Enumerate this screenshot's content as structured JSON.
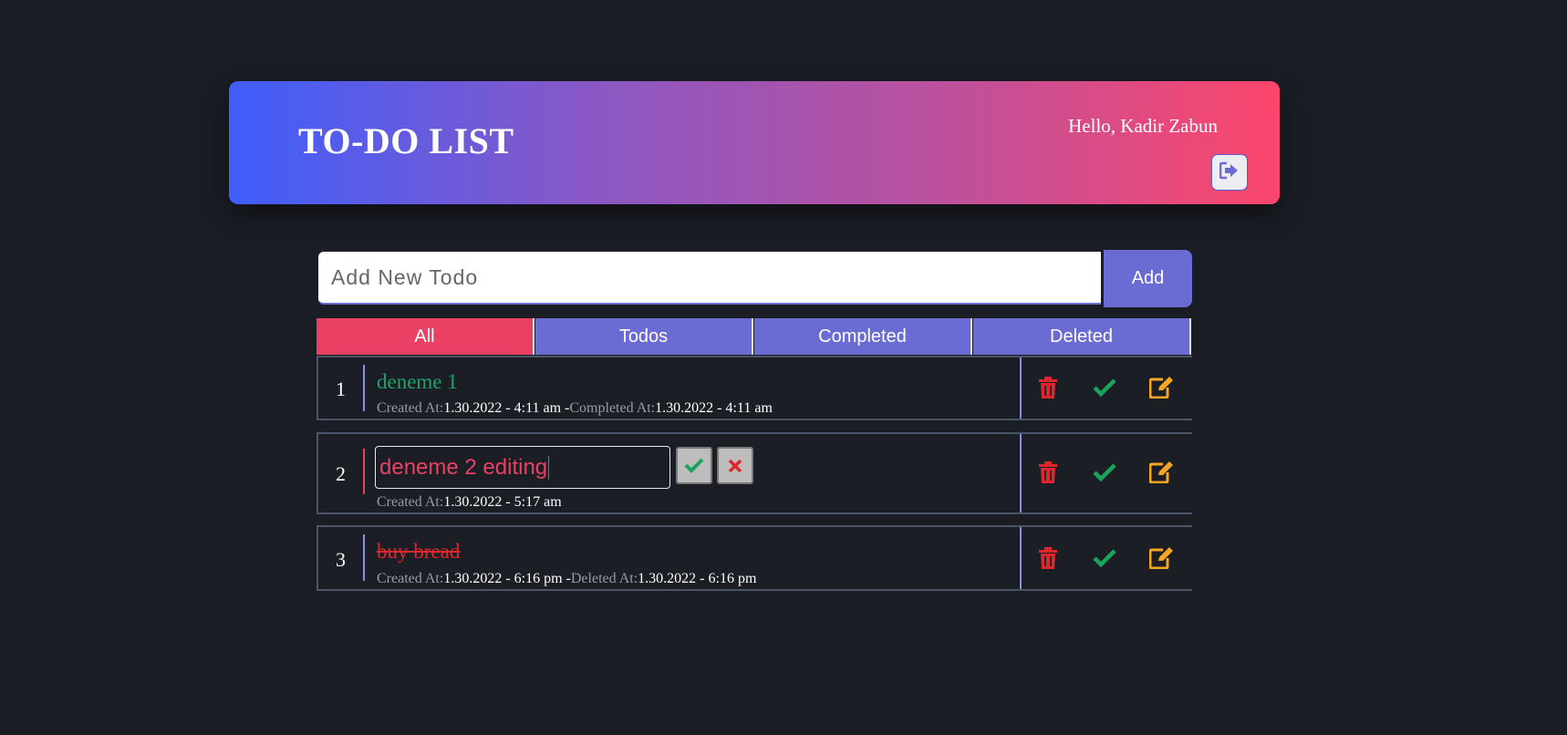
{
  "header": {
    "title": "TO-DO LIST",
    "greeting": "Hello, Kadir Zabun",
    "logout_icon": "sign-out-icon"
  },
  "add_form": {
    "placeholder": "Add New Todo",
    "value": "",
    "button_label": "Add"
  },
  "tabs": [
    {
      "label": "All",
      "active": true
    },
    {
      "label": "Todos",
      "active": false
    },
    {
      "label": "Completed",
      "active": false
    },
    {
      "label": "Deleted",
      "active": false
    }
  ],
  "todos": [
    {
      "number": "1",
      "text": "deneme 1",
      "status": "completed",
      "created_label": "Created At:",
      "created_value": "1.30.2022 - 4:11 am -",
      "second_label": "Completed At:",
      "second_value": "1.30.2022 - 4:11 am"
    },
    {
      "number": "2",
      "text": "deneme 2 editing",
      "status": "editing",
      "created_label": "Created At:",
      "created_value": "1.30.2022 - 5:17 am"
    },
    {
      "number": "3",
      "text": "buy bread",
      "status": "deleted",
      "created_label": "Created At:",
      "created_value": "1.30.2022 - 6:16 pm -",
      "second_label": "Deleted At:",
      "second_value": "1.30.2022 - 6:16 pm"
    }
  ],
  "icons": {
    "delete": "trash-icon",
    "complete": "check-icon",
    "edit": "edit-icon",
    "confirm": "check-icon",
    "cancel": "close-icon"
  },
  "colors": {
    "background": "#1a1d24",
    "accent": "#6b6bd4",
    "active_tab": "#e94063",
    "completed_text": "#1fa36a",
    "deleted_text": "#e0262c",
    "delete_icon": "#e0262c",
    "check_icon": "#19a35c",
    "edit_icon": "#f5a623"
  }
}
